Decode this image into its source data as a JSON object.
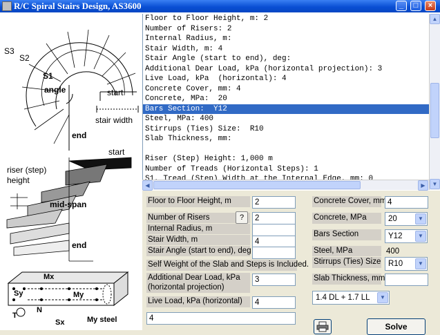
{
  "window": {
    "title": "R/C Spiral Stairs Design, AS3600",
    "minimize": "_",
    "maximize": "□",
    "close": "×"
  },
  "figure": {
    "labels": {
      "s3": "S3",
      "s2": "S2",
      "s1": "S1",
      "angle": "angle",
      "start_top": "start",
      "stair_width": "stair width",
      "end_top": "end",
      "start_side": "start",
      "riser_step": "riser (step)",
      "height": "height",
      "mid_span": "mid-span",
      "end_side": "end"
    },
    "section_labels": {
      "mx": "Mx",
      "sy": "Sy",
      "my": "My",
      "t": "T",
      "n": "N",
      "sx": "Sx",
      "my_steel": "My steel"
    }
  },
  "output": {
    "lines": [
      "Floor to Floor Height, m: 2",
      "Number of Risers: 2",
      "Internal Radius, m:",
      "Stair Width, m: 4",
      "Stair Angle (start to end), deg:",
      "Additional Dear Load, kPa (horizontal projection): 3",
      "Live Load, kPa  (horizontal): 4",
      "Concrete Cover, mm: 4",
      "Concrete, MPa:  20",
      "Bars Section:  Y12",
      "Steel, MPa: 400",
      "Stirrups (Ties) Size:  R10",
      "Slab Thickness, mm:",
      "",
      "Riser (Step) Height: 1,000 m",
      "Number of Treads (Horizontal Steps): 1",
      "S1, Tread (Step) Width at the Internal Edge, mm: 0"
    ],
    "selected_index": 9
  },
  "form": {
    "floor_height": {
      "label": "Floor to Floor Height, m",
      "value": "2"
    },
    "risers": {
      "label": "Number of Risers",
      "value": "2",
      "help": "?"
    },
    "internal_radius": {
      "label": "Internal Radius, m",
      "value": ""
    },
    "stair_width": {
      "label": "Stair Width, m",
      "value": "4"
    },
    "stair_angle": {
      "label": "Stair Angle (start to end), deg",
      "value": ""
    },
    "self_weight_note": "Self Weight of the Slab and Steps is Included.",
    "dead_load": {
      "label_line1": "Additional Dear Load, kPa",
      "label_line2": "(horizontal projection)",
      "value": "3"
    },
    "live_load": {
      "label": "Live Load, kPa  (horizontal)",
      "value": "4"
    },
    "bottom_value": "4",
    "concrete_cover": {
      "label": "Concrete Cover, mm",
      "value": "4"
    },
    "concrete": {
      "label": "Concrete, MPa",
      "value": "20"
    },
    "bars_section": {
      "label": "Bars Section",
      "value": "Y12"
    },
    "steel": {
      "label": "Steel, MPa",
      "value": "400"
    },
    "stirrups": {
      "label": "Stirrups (Ties) Size",
      "value": "R10"
    },
    "slab_thickness": {
      "label": "Slab Thickness, mm",
      "value": ""
    },
    "load_combo": {
      "value": "1.4 DL + 1.7 LL"
    },
    "print_icon": "printer-icon",
    "solve_label": "Solve"
  }
}
